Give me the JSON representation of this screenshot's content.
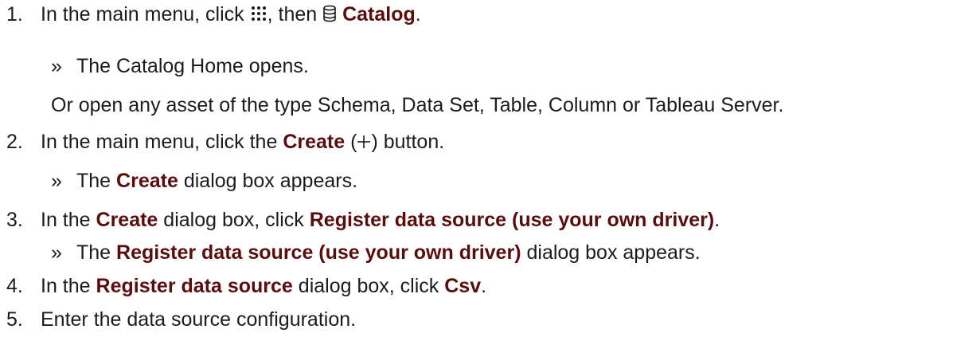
{
  "accent_color": "#5a0d0d",
  "icons": {
    "menu": "grid-icon",
    "catalog": "database-icon",
    "create": "plus-icon"
  },
  "result_marker": "»",
  "steps": [
    {
      "number": "1.",
      "text_a": "In the main menu, click",
      "text_b": ", then",
      "catalog_label": "Catalog",
      "end": ".",
      "result": "The Catalog Home opens.",
      "alternative": "Or open any asset of the type Schema, Data Set, Table, Column or Tableau Server."
    },
    {
      "number": "2.",
      "text_a": "In the main menu, click the",
      "create_label": "Create",
      "paren_open": "(",
      "paren_close": ")",
      "text_b": "button.",
      "result_a": "The",
      "result_create": "Create",
      "result_b": "dialog box appears."
    },
    {
      "number": "3.",
      "text_a": "In the",
      "create_label": "Create",
      "text_b": "dialog box, click",
      "register_label": "Register data source (use your own driver)",
      "end": ".",
      "result_a": "The",
      "result_register": "Register data source (use your own driver)",
      "result_b": "dialog box appears."
    },
    {
      "number": "4.",
      "text_a": "In the",
      "register_label": "Register data source",
      "text_b": "dialog box, click",
      "csv_label": "Csv",
      "end": "."
    },
    {
      "number": "5.",
      "text": "Enter the data source configuration."
    }
  ]
}
